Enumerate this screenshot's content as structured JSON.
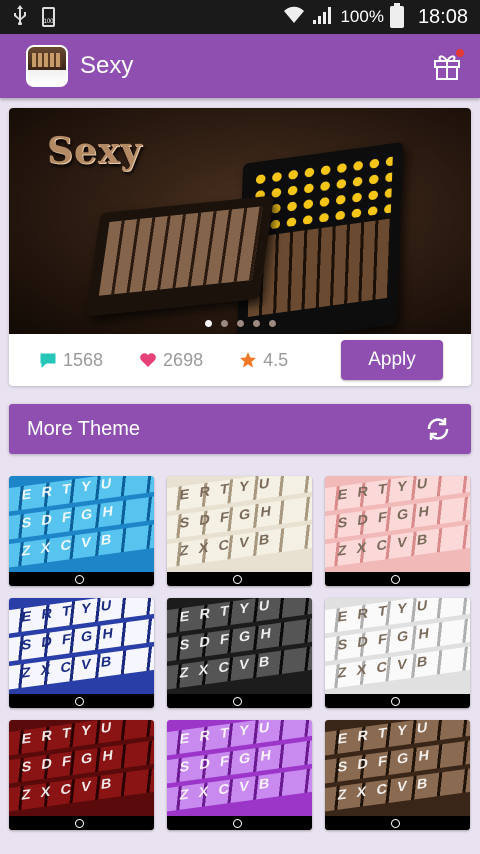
{
  "status_bar": {
    "battery_small_label": "100",
    "battery_percent": "100%",
    "time": "18:08"
  },
  "app_bar": {
    "title": "Sexy",
    "icon": "gift-icon",
    "brand_color": "#8e4fb0"
  },
  "featured": {
    "banner_title": "Sexy",
    "carousel_pages": 5,
    "carousel_active_index": 0,
    "comments_count": "1568",
    "likes_count": "2698",
    "rating": "4.5",
    "apply_label": "Apply",
    "comment_color": "#26c6b8",
    "heart_color": "#e5427a",
    "star_color": "#f07a2a"
  },
  "more_theme": {
    "label": "More Theme",
    "icon": "refresh-icon"
  },
  "themes": [
    {
      "name": "theme-tile-blue",
      "row1": "ERTYU",
      "row2": "SDFGH",
      "row3": "ZXCVB"
    },
    {
      "name": "theme-tile-cream",
      "row1": "ERTYU",
      "row2": "SDFGH",
      "row3": "ZXCVB"
    },
    {
      "name": "theme-tile-pink",
      "row1": "ERTYU",
      "row2": "SDFGH",
      "row3": "ZXCVB"
    },
    {
      "name": "theme-tile-navy",
      "row1": "ERTYU",
      "row2": "SDFGH",
      "row3": "ZXCVB"
    },
    {
      "name": "theme-tile-black",
      "row1": "ERTYU",
      "row2": "SDFGH",
      "row3": "ZXCVB"
    },
    {
      "name": "theme-tile-white",
      "row1": "ERTYU",
      "row2": "SDFGH",
      "row3": "ZXCVB"
    },
    {
      "name": "theme-tile-red",
      "row1": "ERTYU",
      "row2": "SDFGH",
      "row3": "ZXCVB"
    },
    {
      "name": "theme-tile-purple",
      "row1": "ERTYU",
      "row2": "SDFGH",
      "row3": "ZXCVB"
    },
    {
      "name": "theme-tile-leopard",
      "row1": "ERTYU",
      "row2": "SDFGH",
      "row3": "ZXCVB"
    }
  ]
}
